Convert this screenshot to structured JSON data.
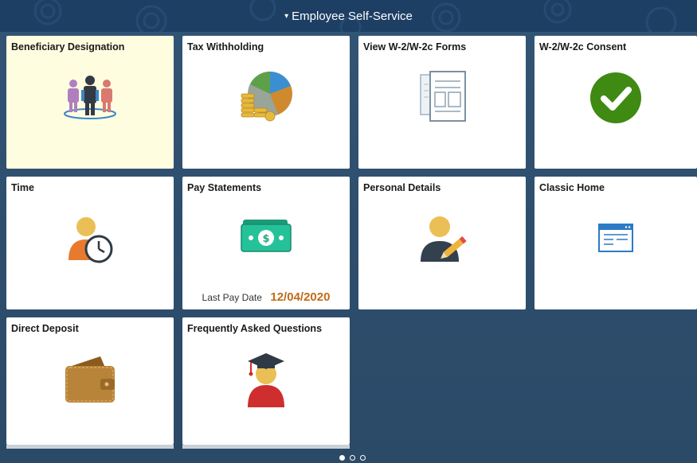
{
  "header": {
    "title": "Employee Self-Service",
    "caret": "▾"
  },
  "tiles": [
    {
      "title": "Beneficiary Designation",
      "icon": "people-group-icon"
    },
    {
      "title": "Tax Withholding",
      "icon": "pie-chart-coins-icon"
    },
    {
      "title": "View W-2/W-2c Forms",
      "icon": "documents-icon"
    },
    {
      "title": "W-2/W-2c Consent",
      "icon": "checkmark-circle-icon"
    },
    {
      "title": "Time",
      "icon": "person-clock-icon"
    },
    {
      "title": "Pay Statements",
      "icon": "cash-bills-icon",
      "last_pay_label": "Last Pay Date",
      "last_pay_value": "12/04/2020"
    },
    {
      "title": "Personal Details",
      "icon": "person-pencil-icon"
    },
    {
      "title": "Classic Home",
      "icon": "browser-window-icon"
    },
    {
      "title": "Direct Deposit",
      "icon": "wallet-icon"
    },
    {
      "title": "Frequently Asked Questions",
      "icon": "graduate-icon"
    }
  ],
  "pager": {
    "pages": 3,
    "current": 1
  },
  "colors": {
    "header": "#1d3f63",
    "background": "#2f4f6f",
    "highlight_tile": "#fffde0",
    "pay_date": "#c06b19"
  }
}
